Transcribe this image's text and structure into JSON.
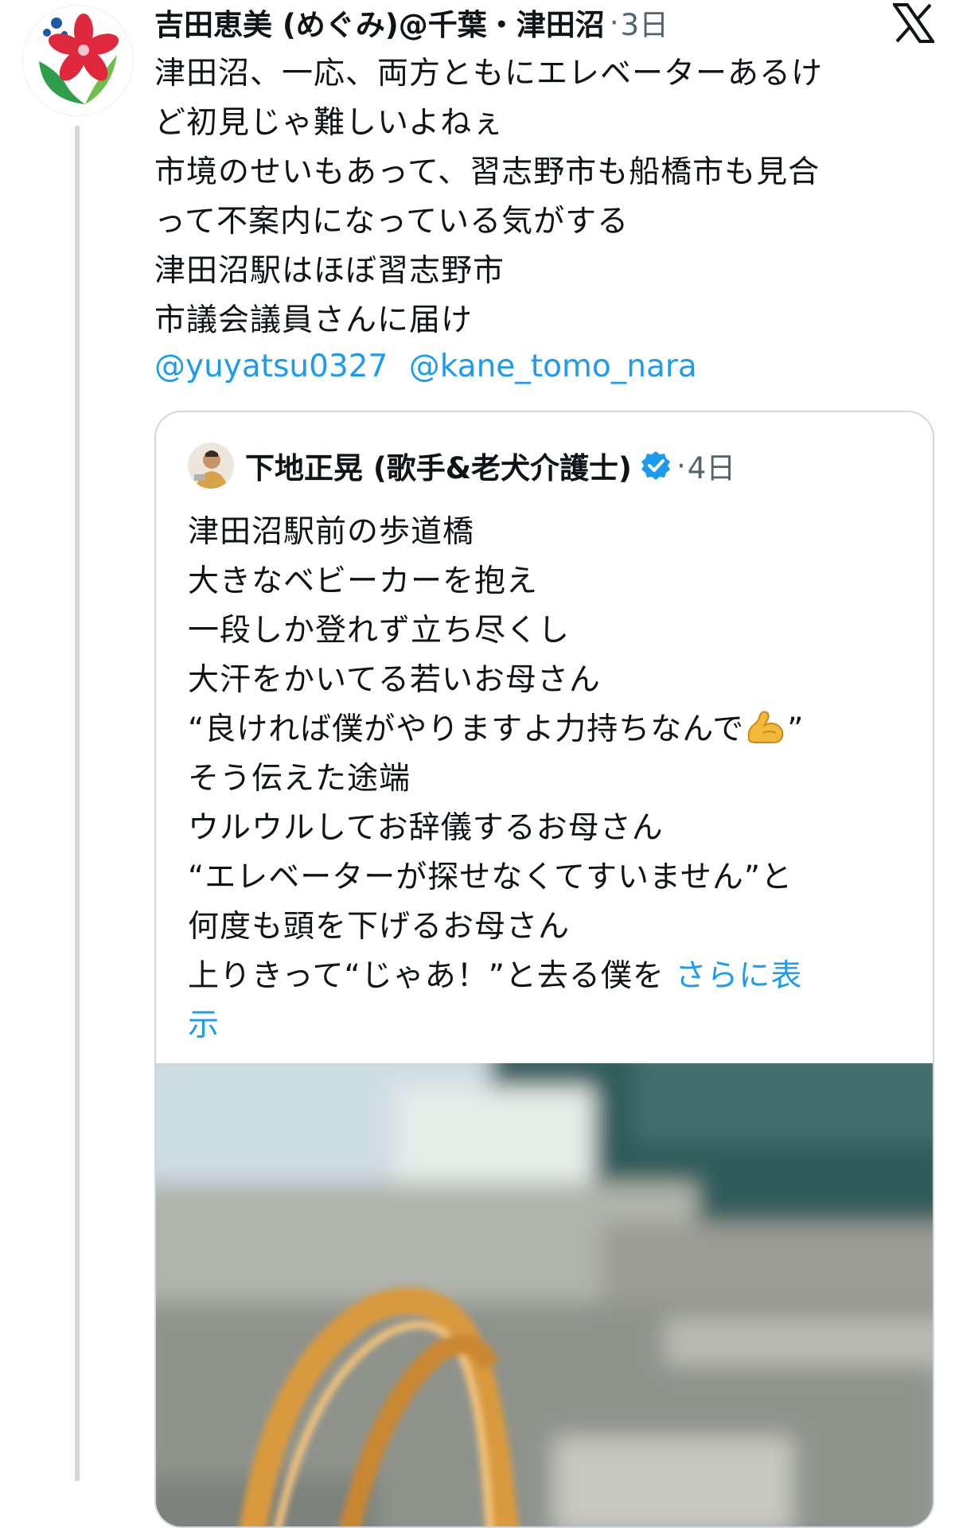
{
  "tweet": {
    "author": {
      "name": "吉田恵美 (めぐみ)@千葉・津田沼",
      "avatar_icon": "flower-logo-avatar"
    },
    "separator": "·",
    "time": "3日",
    "platform_icon": "x-logo-icon",
    "lines": [
      "津田沼、一応、両方ともにエレベーターあるけ",
      "ど初見じゃ難しいよねぇ",
      "市境のせいもあって、習志野市も船橋市も見合",
      "って不案内になっている気がする",
      "津田沼駅はほぼ習志野市",
      "市議会議員さんに届け"
    ],
    "mentions": [
      "@yuyatsu0327",
      "@kane_tomo_nara"
    ]
  },
  "quote": {
    "author": {
      "name": "下地正晃 (歌手&老犬介護士)",
      "verified_icon": "verified-badge-icon",
      "avatar_icon": "person-avatar"
    },
    "separator": "·",
    "time": "4日",
    "lines": [
      "津田沼駅前の歩道橋",
      "大きなベビーカーを抱え",
      "一段しか登れず立ち尽くし",
      "大汗をかいてる若いお母さん"
    ],
    "line_quote_open": "“良ければ僕がやりますよ力持ちなんで",
    "line_quote_emoji": "flexed-biceps-icon",
    "line_quote_close": "”",
    "lines2": [
      "そう伝えた途端",
      "ウルウルしてお辞儀するお母さん",
      "“エレベーターが探せなくてすいません”と",
      "何度も頭を下げるお母さん"
    ],
    "last_line": "上りきって“じゃあ！”と去る僕を",
    "show_more_part1": "さらに表",
    "show_more_part2": "示",
    "photo_alt": "blurred-station-photo"
  },
  "colors": {
    "link": "#1d9bf0",
    "text": "#0f1419",
    "muted": "#536471",
    "border": "#cfd9de"
  }
}
